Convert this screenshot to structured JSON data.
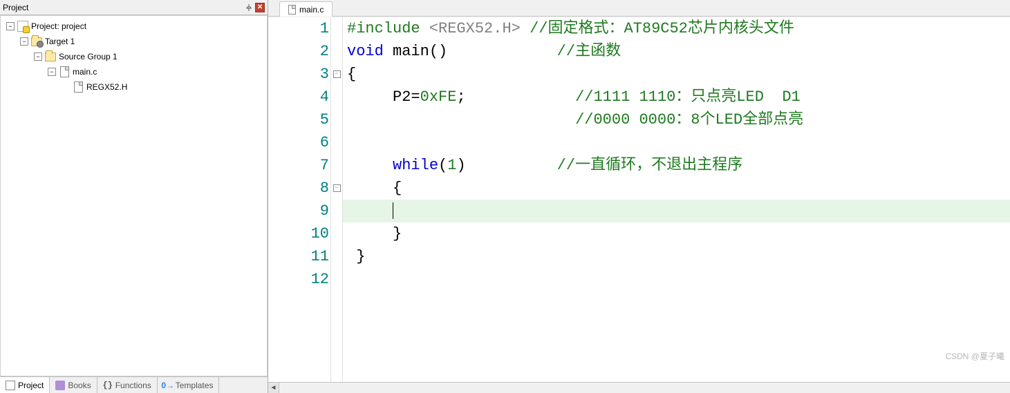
{
  "panel": {
    "title": "Project"
  },
  "tree": {
    "root": "Project: project",
    "target": "Target 1",
    "group": "Source Group 1",
    "file_main": "main.c",
    "file_header": "REGX52.H"
  },
  "bottom_tabs": {
    "project": "Project",
    "books": "Books",
    "functions": "Functions",
    "templates": "Templates"
  },
  "editor_tab": {
    "label": "main.c"
  },
  "code": {
    "line_count": 12,
    "current_line_index": 8,
    "l1": {
      "pp": "#include ",
      "inc": "<REGX52.H>",
      "sp": " ",
      "cmt": "//固定格式：AT89C52芯片内核头文件"
    },
    "l2": {
      "kw": "void",
      "rest": " main()",
      "pad": "            ",
      "cmt": "//主函数"
    },
    "l3": {
      "txt": "{"
    },
    "l4": {
      "indent": "     ",
      "a": "P2=",
      "num": "0xFE",
      "b": ";",
      "pad": "            ",
      "cmt": "//1111 1110：只点亮LED  D1"
    },
    "l5": {
      "pad": "                         ",
      "cmt": "//0000 0000：8个LED全部点亮"
    },
    "l6": {
      "txt": ""
    },
    "l7": {
      "indent": "     ",
      "kw": "while",
      "a": "(",
      "num": "1",
      "b": ")",
      "pad": "          ",
      "cmt": "//一直循环，不退出主程序"
    },
    "l8": {
      "txt": "     {"
    },
    "l9": {
      "txt": "     "
    },
    "l10": {
      "txt": "     }"
    },
    "l11": {
      "txt": " }"
    },
    "l12": {
      "txt": ""
    },
    "nums": {
      "n1": "1",
      "n2": "2",
      "n3": "3",
      "n4": "4",
      "n5": "5",
      "n6": "6",
      "n7": "7",
      "n8": "8",
      "n9": "9",
      "n10": "10",
      "n11": "11",
      "n12": "12"
    }
  },
  "watermark": "CSDN @夏子曦"
}
